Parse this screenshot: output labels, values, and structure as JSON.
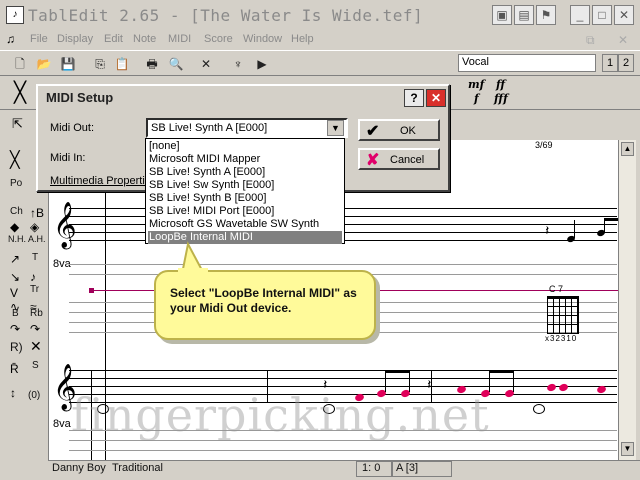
{
  "window": {
    "title": "TablEdit 2.65 - [The Water Is Wide.tef]"
  },
  "menu": [
    "File",
    "Display",
    "Edit",
    "Note",
    "MIDI",
    "Score",
    "Window",
    "Help"
  ],
  "toolbar": {
    "instrument_select": "Vocal",
    "track_buttons": [
      "1",
      "2"
    ],
    "dynamics": [
      "mf",
      "ff",
      "f",
      "fff"
    ]
  },
  "palette": {
    "labels": [
      "Po",
      "Ch",
      "N.H.",
      "A.H.",
      "B",
      "Rb",
      "R)",
      "S",
      "(0)",
      "T",
      "Tr"
    ]
  },
  "dialog": {
    "title": "MIDI Setup",
    "help_label": "?",
    "close_label": "✕",
    "midi_out_label": "Midi Out:",
    "midi_out_value": "SB Live! Synth A [E000]",
    "midi_in_label": "Midi In:",
    "multimedia_label": "Multimedia Propertie",
    "ok_label": "OK",
    "cancel_label": "Cancel"
  },
  "dropdown": {
    "options": [
      "[none]",
      "Microsoft MIDI Mapper",
      "SB Live! Synth A [E000]",
      "SB Live! Sw Synth [E000]",
      "SB Live! Synth B [E000]",
      "SB Live! MIDI Port [E000]",
      "Microsoft GS Wavetable SW Synth",
      "LoopBe Internal MIDI"
    ],
    "selected_index": 7
  },
  "callout": {
    "text": "Select \"LoopBe Internal MIDI\" as your Midi Out device."
  },
  "score": {
    "measure_counter": "3/69",
    "chord_name": "C 7",
    "chord_fingering": "x32310",
    "watermark": "fingerpicking.net"
  },
  "status": {
    "song": "Danny Boy",
    "style": "Traditional",
    "position": "1: 0",
    "string_info": "A [3]"
  },
  "colors": {
    "note_accent": "#e0005a",
    "callout_bg": "#fffa9a",
    "cursor_line": "#a0005a"
  }
}
